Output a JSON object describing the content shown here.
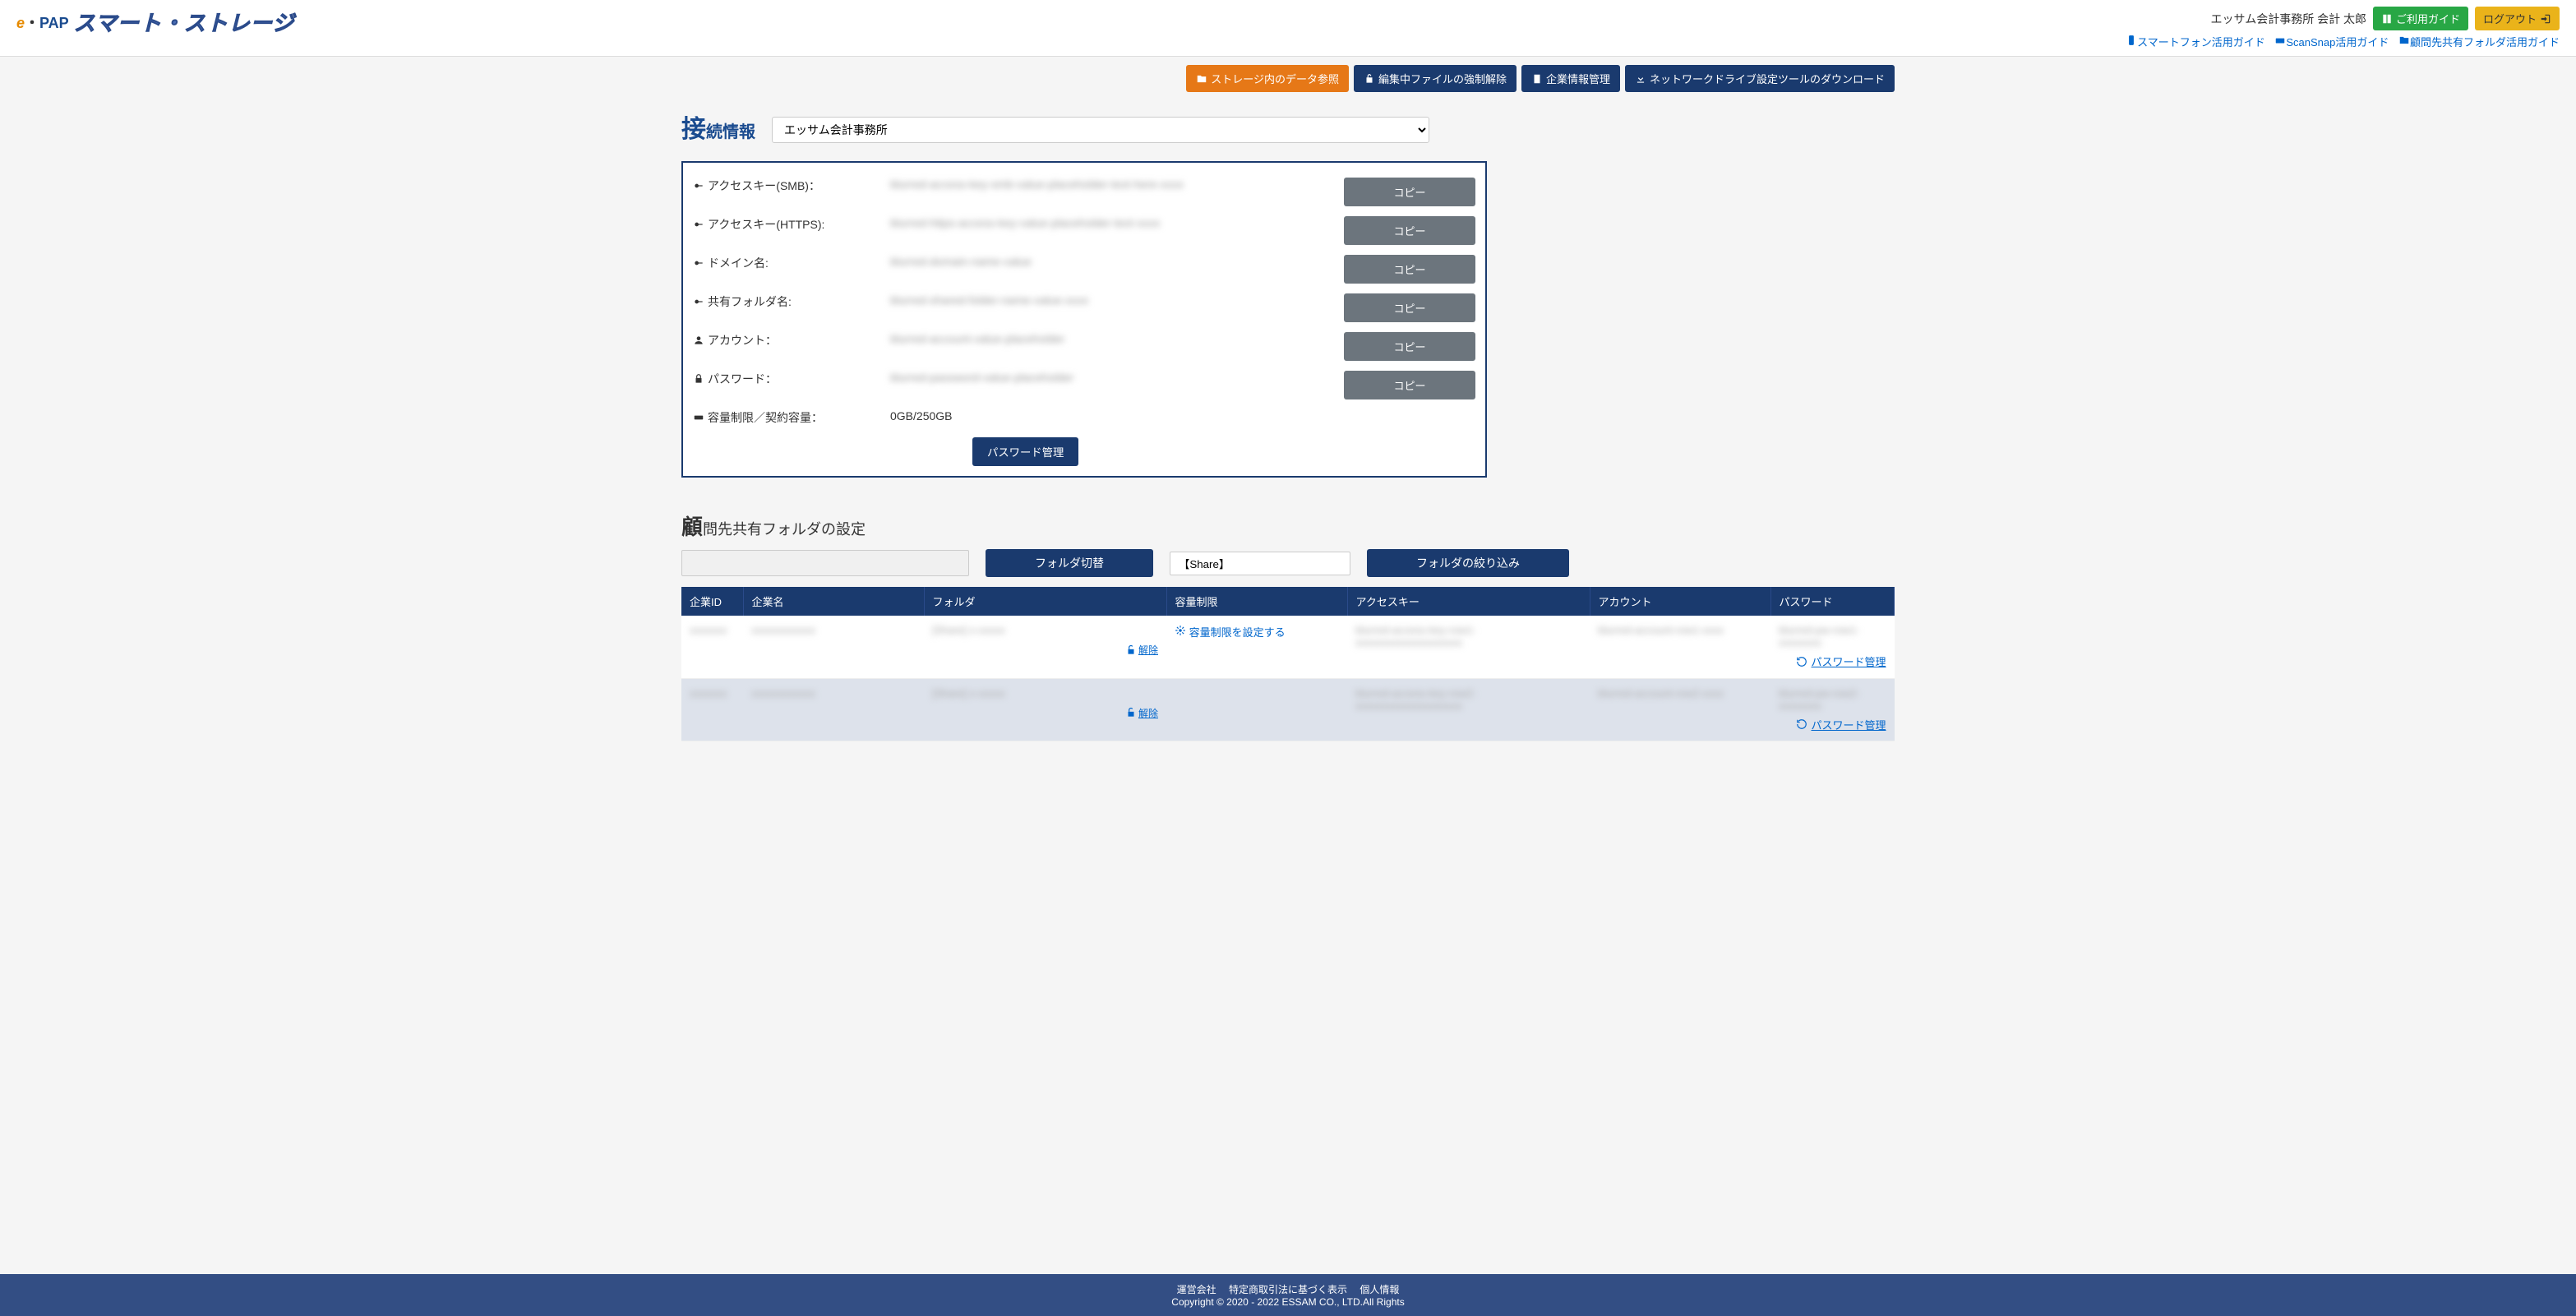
{
  "header": {
    "logo_e": "e",
    "logo_dot": "・",
    "logo_pap": "PAP",
    "logo_text": "スマート・ストレージ",
    "user_info": "エッサム会計事務所 会計 太郎",
    "guide_btn": "ご利用ガイド",
    "logout_btn": "ログアウト",
    "links": {
      "smartphone": "スマートフォン活用ガイド",
      "scansnap": "ScanSnap活用ガイド",
      "sharefolder": "顧問先共有フォルダ活用ガイド"
    }
  },
  "nav": {
    "storage": "ストレージ内のデータ参照",
    "unlock": "編集中ファイルの強制解除",
    "company": "企業情報管理",
    "download": "ネットワークドライブ設定ツールのダウンロード"
  },
  "connection": {
    "title_big": "接",
    "title_rest": "続情報",
    "office": "エッサム会計事務所",
    "rows": {
      "smb_label": "アクセスキー(SMB)：",
      "smb_value": "blurred-access-key-smb-value-placeholder-text-here-xxxx",
      "https_label": "アクセスキー(HTTPS):",
      "https_value": "blurred-https-access-key-value-placeholder-text-xxxx",
      "domain_label": "ドメイン名:",
      "domain_value": "blurred-domain-name-value",
      "folder_label": "共有フォルダ名:",
      "folder_value": "blurred-shared-folder-name-value-xxxx",
      "account_label": "アカウント：",
      "account_value": "blurred-account-value-placeholder",
      "password_label": "パスワード：",
      "password_value": "blurred-password-value-placeholder",
      "capacity_label": "容量制限／契約容量：",
      "capacity_value": "0GB/250GB"
    },
    "copy_btn": "コピー",
    "pw_manage": "パスワード管理"
  },
  "folder": {
    "title_big": "顧",
    "title_rest": "問先共有フォルダの設定",
    "switch_btn": "フォルダ切替",
    "share_value": "【Share】",
    "filter_btn": "フォルダの絞り込み",
    "headers": {
      "id": "企業ID",
      "name": "企業名",
      "folder": "フォルダ",
      "capacity": "容量制限",
      "access": "アクセスキー",
      "account": "アカウント",
      "password": "パスワード"
    },
    "rows": [
      {
        "id": "xxxxxxx",
        "name": "xxxxxxxxxxxx",
        "folder": "[Share] x-xxxxx",
        "unlock": "解除",
        "capacity_link": "容量制限を設定する",
        "access": "blurred-access-key-row1-xxxxxxxxxxxxxxxxxxxx",
        "account": "blurred-account-row1-xxxx",
        "password": "blurred-pw-row1-xxxxxxxx",
        "pw_link": "パスワード管理"
      },
      {
        "id": "xxxxxxx",
        "name": "xxxxxxxxxxxx",
        "folder": "[Share] x-xxxxx",
        "unlock": "解除",
        "capacity_link": "",
        "access": "blurred-access-key-row2-xxxxxxxxxxxxxxxxxxxx",
        "account": "blurred-account-row2-xxxx",
        "password": "blurred-pw-row2-xxxxxxxx",
        "pw_link": "パスワード管理"
      }
    ]
  },
  "footer": {
    "links": {
      "company": "運営会社",
      "law": "特定商取引法に基づく表示",
      "privacy": "個人情報"
    },
    "copyright": "Copyright © 2020 - 2022 ESSAM CO., LTD.All Rights"
  }
}
